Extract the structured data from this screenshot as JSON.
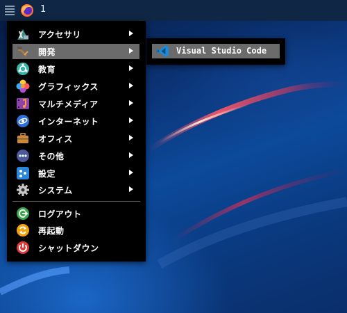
{
  "panel": {
    "menu_icon": "hamburger-menu-icon",
    "browser_icon": "firefox-icon",
    "workspace": "1"
  },
  "menu": {
    "items": [
      {
        "label": "アクセサリ",
        "icon": "accessories-icon",
        "has_submenu": true
      },
      {
        "label": "開発",
        "icon": "development-icon",
        "has_submenu": true,
        "active": true
      },
      {
        "label": "教育",
        "icon": "education-icon",
        "has_submenu": true
      },
      {
        "label": "グラフィックス",
        "icon": "graphics-icon",
        "has_submenu": true
      },
      {
        "label": "マルチメディア",
        "icon": "multimedia-icon",
        "has_submenu": true
      },
      {
        "label": "インターネット",
        "icon": "internet-icon",
        "has_submenu": true
      },
      {
        "label": "オフィス",
        "icon": "office-icon",
        "has_submenu": true
      },
      {
        "label": "その他",
        "icon": "other-icon",
        "has_submenu": true
      },
      {
        "label": "設定",
        "icon": "settings-icon",
        "has_submenu": true
      },
      {
        "label": "システム",
        "icon": "system-gear-icon",
        "has_submenu": true
      }
    ],
    "session_items": [
      {
        "label": "ログアウト",
        "icon": "logout-icon"
      },
      {
        "label": "再起動",
        "icon": "restart-icon"
      },
      {
        "label": "シャットダウン",
        "icon": "shutdown-icon"
      }
    ]
  },
  "submenu": {
    "items": [
      {
        "label": "Visual Studio Code",
        "icon": "vscode-icon"
      }
    ]
  },
  "colors": {
    "menu_bg": "#000000",
    "highlight": "#6b6b6b",
    "panel_bg": "#0f2744",
    "wallpaper_accent": "#e03a5a"
  }
}
